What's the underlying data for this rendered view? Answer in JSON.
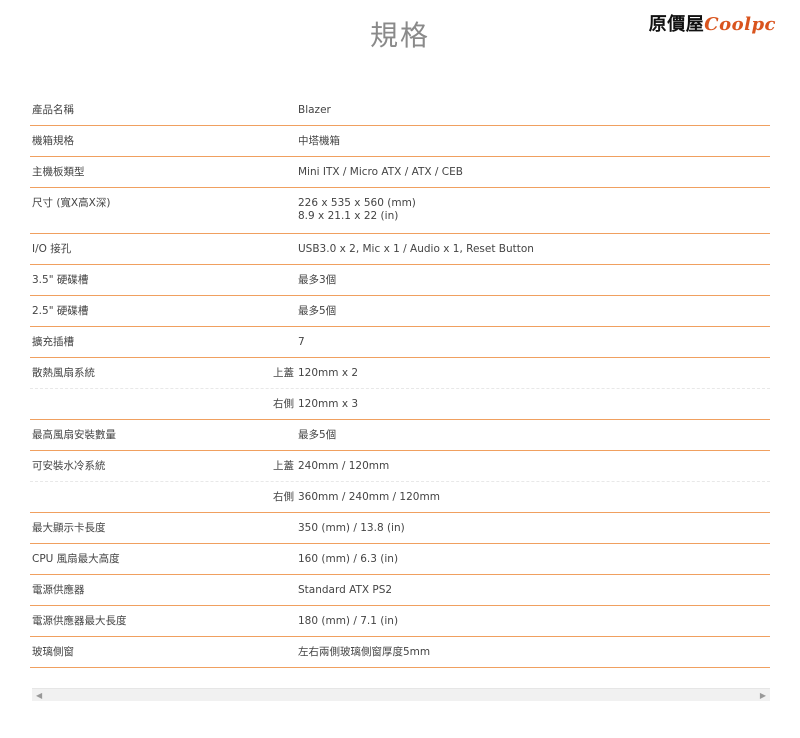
{
  "page": {
    "title": "規格",
    "brand_main": "原價屋",
    "brand_accent": "Coolpc"
  },
  "specs": [
    {
      "label": "產品名稱",
      "sub": "",
      "value": "Blazer"
    },
    {
      "label": "機箱規格",
      "sub": "",
      "value": "中塔機箱"
    },
    {
      "label": "主機板類型",
      "sub": "",
      "value": "Mini ITX / Micro ATX / ATX / CEB"
    },
    {
      "label": "尺寸 (寬X高X深)",
      "sub": "",
      "value": "226 x 535 x 560 (mm)",
      "value2": "8.9 x 21.1 x 22 (in)"
    },
    {
      "label": "I/O 接孔",
      "sub": "",
      "value": "USB3.0 x 2, Mic x 1 / Audio x 1, Reset Button"
    },
    {
      "label": "3.5\" 硬碟槽",
      "sub": "",
      "value": "最多3個"
    },
    {
      "label": "2.5\" 硬碟槽",
      "sub": "",
      "value": "最多5個"
    },
    {
      "label": "擴充插槽",
      "sub": "",
      "value": "7"
    },
    {
      "label": "散熱風扇系統",
      "sub": "上蓋",
      "value": "120mm x 2"
    },
    {
      "label": "",
      "sub": "右側",
      "value": "120mm x 3"
    },
    {
      "label": "最高風扇安裝數量",
      "sub": "",
      "value": "最多5個"
    },
    {
      "label": "可安裝水冷系統",
      "sub": "上蓋",
      "value": "240mm / 120mm"
    },
    {
      "label": "",
      "sub": "右側",
      "value": "360mm / 240mm / 120mm"
    },
    {
      "label": "最大顯示卡長度",
      "sub": "",
      "value": "350 (mm) / 13.8 (in)"
    },
    {
      "label": "CPU 風扇最大高度",
      "sub": "",
      "value": "160 (mm) / 6.3 (in)"
    },
    {
      "label": "電源供應器",
      "sub": "",
      "value": "Standard ATX PS2"
    },
    {
      "label": "電源供應器最大長度",
      "sub": "",
      "value": "180 (mm) / 7.1 (in)"
    },
    {
      "label": "玻璃側窗",
      "sub": "",
      "value": "左右兩側玻璃側窗厚度5mm"
    }
  ]
}
